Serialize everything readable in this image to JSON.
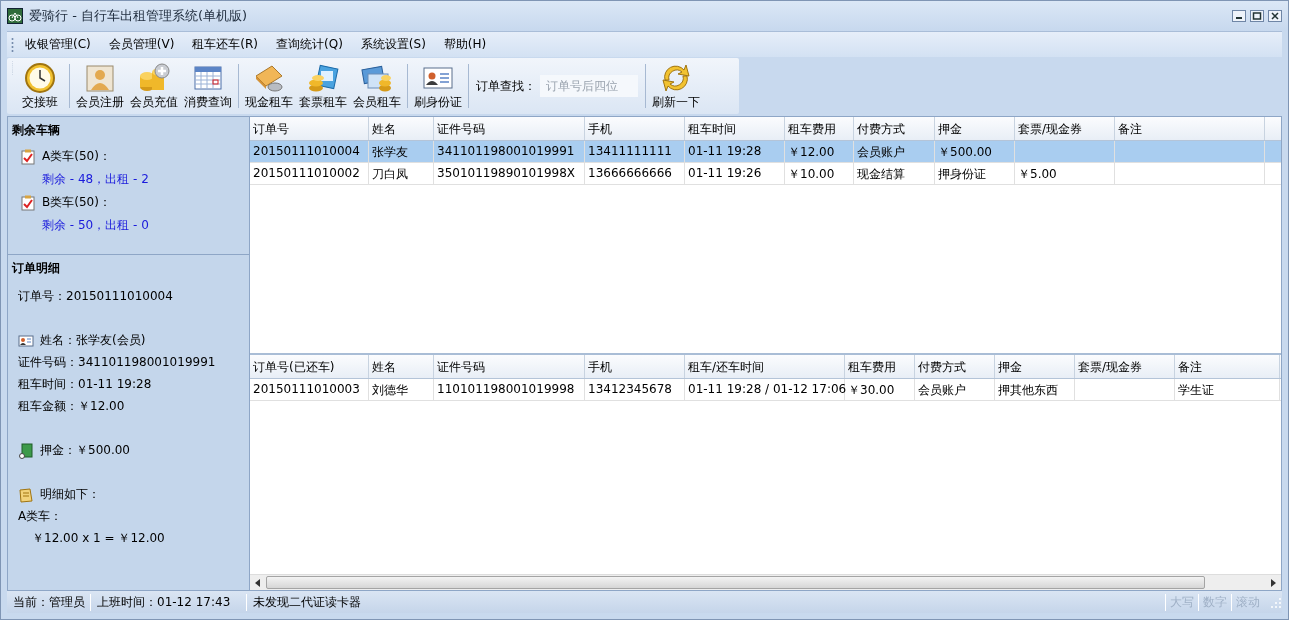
{
  "window": {
    "title": "爱骑行 - 自行车出租管理系统(单机版)"
  },
  "menu": [
    "收银管理(C)",
    "会员管理(V)",
    "租车还车(R)",
    "查询统计(Q)",
    "系统设置(S)",
    "帮助(H)"
  ],
  "toolbar": {
    "groups": [
      {
        "buttons": [
          {
            "label": "交接班",
            "kind": "clock"
          }
        ]
      },
      {
        "buttons": [
          {
            "label": "会员注册",
            "kind": "member"
          },
          {
            "label": "会员充值",
            "kind": "coins"
          },
          {
            "label": "消费查询",
            "kind": "calendar"
          }
        ]
      },
      {
        "buttons": [
          {
            "label": "现金租车",
            "kind": "cash"
          },
          {
            "label": "套票租车",
            "kind": "ticket"
          },
          {
            "label": "会员租车",
            "kind": "card"
          }
        ]
      },
      {
        "buttons": [
          {
            "label": "刷身份证",
            "kind": "idcard"
          }
        ]
      }
    ],
    "search": {
      "label": "订单查找：",
      "placeholder": "订单号后四位"
    },
    "refresh": {
      "label": "刷新一下"
    }
  },
  "sidebar": {
    "vehicles": {
      "title": "剩余车辆",
      "items": [
        {
          "name": "A类车(50)：",
          "status": "剩余 - 48，出租 - 2"
        },
        {
          "name": "B类车(50)：",
          "status": "剩余 - 50，出租 - 0"
        }
      ]
    },
    "order_detail": {
      "title": "订单明细",
      "lines": [
        {
          "kind": "plain",
          "text": "订单号：20150111010004"
        },
        {
          "kind": "person",
          "text": "姓名：张学友(会员)"
        },
        {
          "kind": "plain",
          "text": "证件号码：341101198001019991"
        },
        {
          "kind": "plain",
          "text": "租车时间：01-11 19:28"
        },
        {
          "kind": "plain",
          "text": "租车金额：￥12.00"
        },
        {
          "kind": "deposit",
          "text": "押金：￥500.00"
        },
        {
          "kind": "note",
          "text": "明细如下："
        },
        {
          "kind": "plain",
          "text": "A类车："
        },
        {
          "kind": "indent",
          "text": "￥12.00 x 1 = ￥12.00"
        }
      ]
    }
  },
  "current_orders": {
    "columns": [
      "订单号",
      "姓名",
      "证件号码",
      "手机",
      "租车时间",
      "租车费用",
      "付费方式",
      "押金",
      "套票/现金券",
      "备注"
    ],
    "rows": [
      {
        "selected": true,
        "cells": [
          "20150111010004",
          "张学友",
          "341101198001019991",
          "13411111111",
          "01-11 19:28",
          "￥12.00",
          "会员账户",
          "￥500.00",
          "",
          ""
        ]
      },
      {
        "selected": false,
        "cells": [
          "20150111010002",
          "刀白凤",
          "35010119890101998X",
          "13666666666",
          "01-11 19:26",
          "￥10.00",
          "现金结算",
          "押身份证",
          "￥5.00",
          ""
        ]
      }
    ]
  },
  "returned_orders": {
    "columns": [
      "订单号(已还车)",
      "姓名",
      "证件号码",
      "手机",
      "租车/还车时间",
      "租车费用",
      "付费方式",
      "押金",
      "套票/现金券",
      "备注"
    ],
    "rows": [
      {
        "selected": false,
        "cells": [
          "20150111010003",
          "刘德华",
          "110101198001019998",
          "13412345678",
          "01-11 19:28 / 01-12 17:06",
          "￥30.00",
          "会员账户",
          "押其他东西",
          "",
          "学生证"
        ]
      }
    ]
  },
  "status_bar": {
    "user": "当前：管理员",
    "shift": "上班时间：01-12 17:43",
    "message": "未发现二代证读卡器",
    "indicators": [
      {
        "label": "大写",
        "on": false
      },
      {
        "label": "数字",
        "on": false
      },
      {
        "label": "滚动",
        "on": false
      }
    ]
  }
}
